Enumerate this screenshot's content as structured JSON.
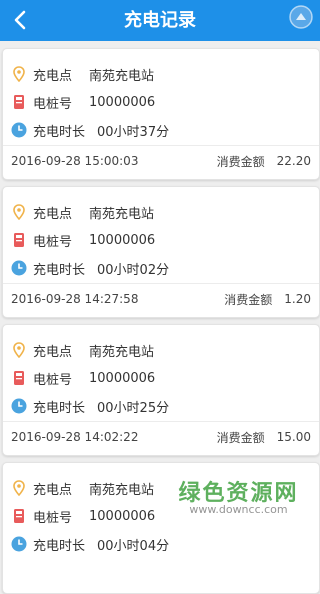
{
  "header": {
    "title": "充电记录"
  },
  "labels": {
    "station": "充电点",
    "pile": "电桩号",
    "duration": "充电时长",
    "amount": "消费金额"
  },
  "records": [
    {
      "station": "南苑充电站",
      "pile": "10000006",
      "duration": "00小时37分",
      "time": "2016-09-28 15:00:03",
      "amount": "22.20"
    },
    {
      "station": "南苑充电站",
      "pile": "10000006",
      "duration": "00小时02分",
      "time": "2016-09-28 14:27:58",
      "amount": "1.20"
    },
    {
      "station": "南苑充电站",
      "pile": "10000006",
      "duration": "00小时25分",
      "time": "2016-09-28 14:02:22",
      "amount": "15.00"
    },
    {
      "station": "南苑充电站",
      "pile": "10000006",
      "duration": "00小时04分",
      "time": "",
      "amount": ""
    }
  ],
  "watermark": {
    "name": "绿色资源网",
    "url": "www.downcc.com"
  },
  "colors": {
    "header": "#1e90e8",
    "pin": "#f0b34a",
    "pile": "#e85b5b",
    "clock": "#4aa3df"
  },
  "icons": {
    "back": "back-arrow-icon",
    "pin": "location-pin-icon",
    "pile": "charging-pile-icon",
    "clock": "clock-icon"
  }
}
